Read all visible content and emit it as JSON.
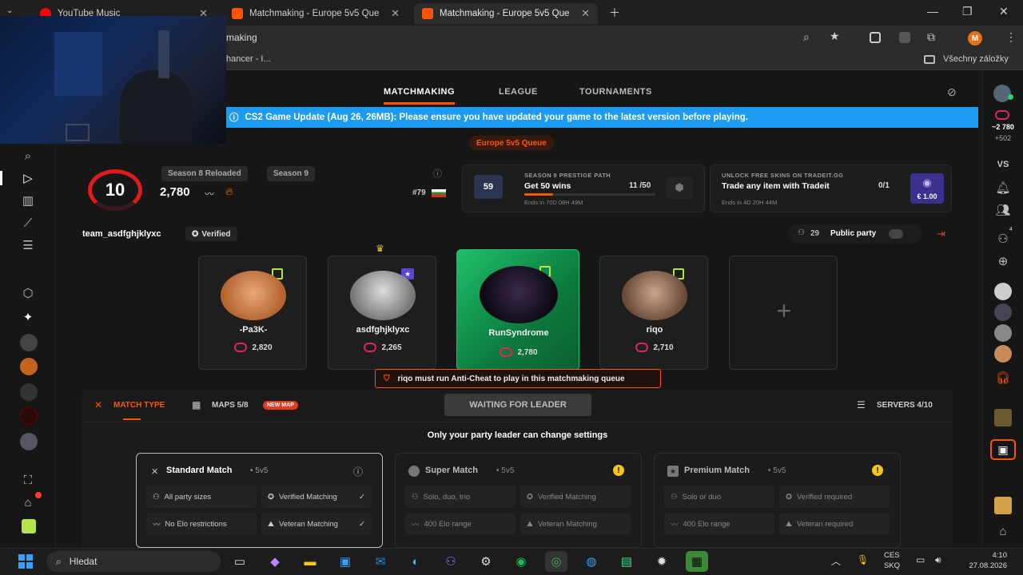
{
  "browser": {
    "tabs": [
      {
        "title": "YouTube Music",
        "color": "#ff0000"
      },
      {
        "title": "Matchmaking - Europe 5v5 Que",
        "color": "#ff5500"
      },
      {
        "title": "Matchmaking - Europe 5v5 Que",
        "color": "#ff5500"
      }
    ],
    "address_fragment": "making",
    "bookmark_fragment": "hancer - I...",
    "bookmarks_folder": "Všechny záložky",
    "profile_initial": "M"
  },
  "topnav": {
    "items": [
      "MATCHMAKING",
      "LEAGUE",
      "TOURNAMENTS"
    ],
    "active": "MATCHMAKING"
  },
  "banner": {
    "text": "CS2 Game Update (Aug 26, 26MB): Please ensure you have updated your game to the latest version before playing."
  },
  "queue_label": "Europe 5v5 Queue",
  "profile": {
    "level": "10",
    "elo": "2,780",
    "season_tags": [
      "Season 8 Reloaded",
      "Season 9"
    ],
    "rank": "#79",
    "username": "team_asdfghjklyxc",
    "verified_label": "Verified"
  },
  "prestige": {
    "heading": "SEASON 9 PRESTIGE PATH",
    "badge": "59",
    "title": "Get 50 wins",
    "progress_text": "11 /50",
    "progress": 0.22,
    "ends": "Ends in 70D 08H 49M"
  },
  "tradeit": {
    "heading": "UNLOCK FREE SKINS ON TRADEIT.GG",
    "title": "Trade any item with Tradeit",
    "progress_text": "0/1",
    "reward": "€ 1.00",
    "ends": "Ends in 4D 20H 44M"
  },
  "party": {
    "count": "29",
    "label": "Public party"
  },
  "players": [
    {
      "name": "-Pa3K-",
      "elo": "2,820",
      "badge_color": "#b7e34a"
    },
    {
      "name": "asdfghjklyxc",
      "elo": "2,265",
      "badge_color": "#7b5cff"
    },
    {
      "name": "RunSyndrome",
      "elo": "2,780",
      "badge_color": "#b7e34a"
    },
    {
      "name": "riqo",
      "elo": "2,710",
      "badge_color": "#b7e34a"
    }
  ],
  "warning": "riqo must run Anti-Cheat to play in this matchmaking queue",
  "settings_bar": {
    "match_type": "MATCH TYPE",
    "maps": "MAPS 5/8",
    "new_map": "NEW MAP",
    "waiting": "WAITING FOR LEADER",
    "servers": "SERVERS 4/10"
  },
  "leader_notice": "Only your party leader can change settings",
  "match_modes": [
    {
      "title": "Standard Match",
      "mode": "• 5v5",
      "chips": [
        "All party sizes",
        "Verified Matching",
        "No Elo restrictions",
        "Veteran Matching"
      ]
    },
    {
      "title": "Super Match",
      "mode": "• 5v5",
      "chips": [
        "Solo, duo, trio",
        "Verified Matching",
        "400 Elo range",
        "Veteran Matching"
      ]
    },
    {
      "title": "Premium Match",
      "mode": "• 5v5",
      "chips": [
        "Solo or duo",
        "Verified required",
        "400 Elo range",
        "Veteran required"
      ]
    }
  ],
  "rightbar": {
    "elo": "~2 780",
    "delta": "+502",
    "vs": "VS",
    "party_count": "4"
  },
  "taskbar": {
    "search": "Hledat",
    "lang1": "CES",
    "lang2": "SKQ",
    "time": "4:10",
    "date": "27.08.2026"
  },
  "colors": {
    "accent": "#ff5500",
    "banner": "#1d9bf0",
    "warning": "#ff5500"
  }
}
